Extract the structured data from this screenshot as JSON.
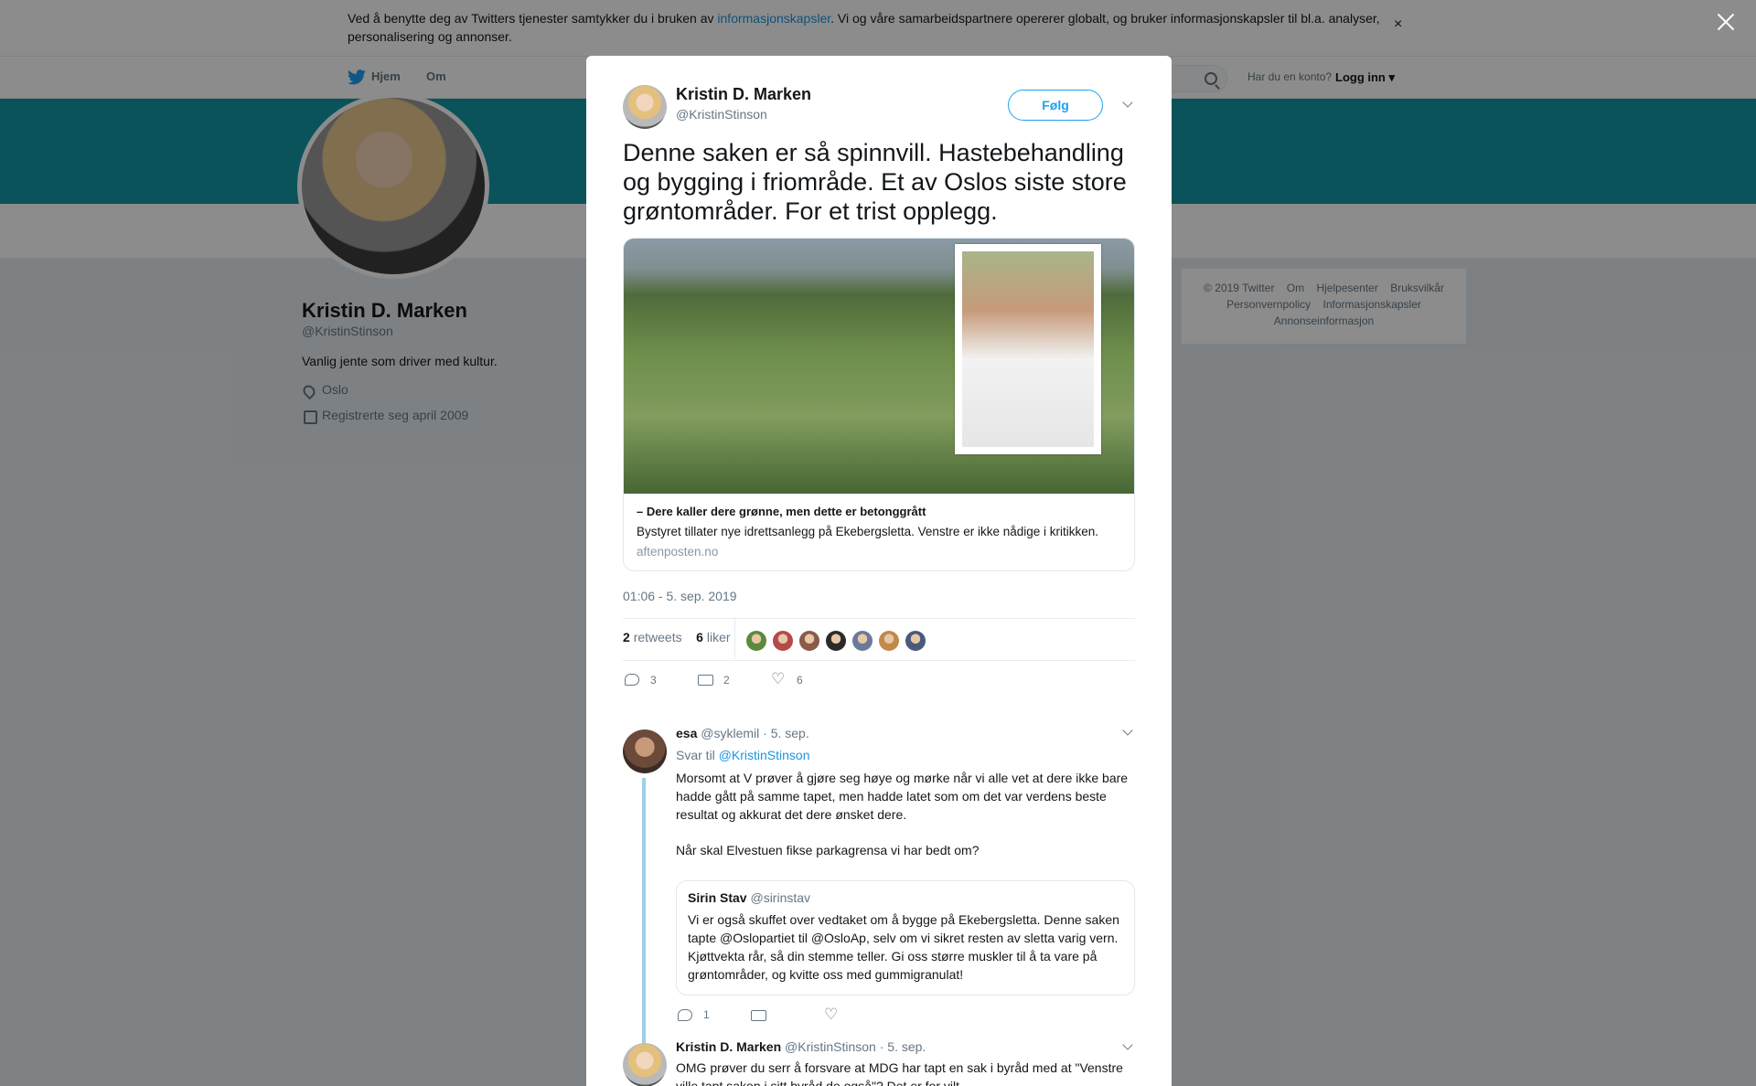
{
  "cookie_banner": {
    "text_before": "Ved å benytte deg av Twitters tjenester samtykker du i bruken av ",
    "link": "informasjonskapsler",
    "text_after": ". Vi og våre samarbeidspartnere opererer globalt, og bruker informasjonskapsler til bl.a. analyser, personalisering og annonser.",
    "close": "×"
  },
  "nav": {
    "home": "Hjem",
    "about": "Om",
    "account_question": "Har du en konto?",
    "login": "Logg inn"
  },
  "profile": {
    "name": "Kristin D. Marken",
    "handle": "@KristinStinson",
    "bio": "Vanlig jente som driver med kultur.",
    "location": "Oslo",
    "joined": "Registrerte seg april 2009"
  },
  "footer": {
    "links": [
      "© 2019 Twitter",
      "Om",
      "Hjelpesenter",
      "Bruksvilkår",
      "Personvernpolicy",
      "Informasjonskapsler",
      "Annonseinformasjon"
    ]
  },
  "tweet": {
    "name": "Kristin D. Marken",
    "handle": "@KristinStinson",
    "follow_label": "Følg",
    "text": "Denne saken er så spinnvill. Hastebehandling og bygging i friområde. Et av Oslos siste store grøntområder. For et trist opplegg.",
    "card": {
      "title": "– Dere kaller dere grønne, men dette er betonggrått",
      "description": "Bystyret tillater nye idrettsanlegg på Ekebergsletta. Venstre er ikke nådige i kritikken.",
      "domain": "aftenposten.no"
    },
    "timestamp": "01:06 - 5. sep. 2019",
    "retweets_count": "2",
    "retweets_label": "retweets",
    "likes_count": "6",
    "likes_label": "liker",
    "likers_colors": [
      "#5a8a3c",
      "#b54a4a",
      "#8a5a4a",
      "#2a2a2a",
      "#6a7a9a",
      "#c08a4a",
      "#4a5a7a"
    ],
    "actions": {
      "replies": "3",
      "retweets": "2",
      "likes": "6"
    }
  },
  "replies": [
    {
      "name": "esa",
      "handle": "@syklemil",
      "time": "· 5. sep.",
      "reply_to_label": "Svar til",
      "reply_to": "@KristinStinson",
      "text_p1": "Morsomt at V prøver å gjøre seg høye og mørke når vi alle vet at dere ikke bare hadde gått på samme tapet, men hadde latet som om det var verdens beste resultat og akkurat det dere ønsket dere.",
      "text_p2": "Når skal Elvestuen fikse parkagrensa vi har bedt om?",
      "quote": {
        "name": "Sirin Stav",
        "handle": "@sirinstav",
        "text": "Vi er også skuffet over vedtaket om å bygge på Ekebergsletta. Denne saken tapte @Oslopartiet til @OsloAp, selv om vi sikret resten av sletta varig vern. Kjøttvekta rår, så din stemme teller. Gi oss større muskler til å ta vare på grøntområder, og kvitte oss med gummigranulat!"
      },
      "actions": {
        "replies": "1"
      }
    },
    {
      "name": "Kristin D. Marken",
      "handle": "@KristinStinson",
      "time": "· 5. sep.",
      "text": "OMG prøver du serr å forsvare at MDG har tapt en sak i byråd med at \"Venstre ville tapt saken i sitt byråd de også\"? Det er for vilt."
    }
  ]
}
